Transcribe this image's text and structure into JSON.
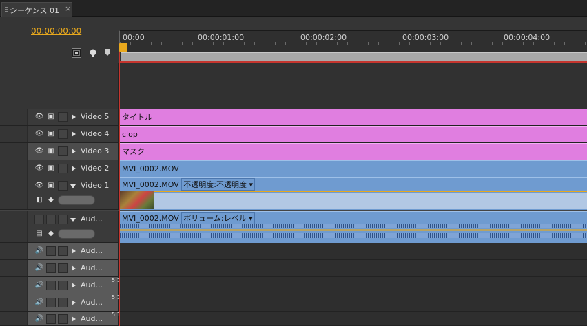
{
  "tab": {
    "title": "シーケンス 01",
    "close": "×"
  },
  "timecode": "00:00:00:00",
  "ruler": {
    "ticks": [
      "00:00",
      "00:00:01:00",
      "00:00:02:00",
      "00:00:03:00",
      "00:00:04:00"
    ]
  },
  "tracks": [
    {
      "name": "Video 5",
      "clip": "タイトル",
      "kind": "video",
      "clip_color": "#e07ee0"
    },
    {
      "name": "Video 4",
      "clip": "clop",
      "kind": "video",
      "clip_color": "#e07ee0"
    },
    {
      "name": "Video 3",
      "clip": "マスク",
      "kind": "video",
      "clip_color": "#e07ee0"
    },
    {
      "name": "Video 2",
      "clip": "MVI_0002.MOV",
      "kind": "video",
      "clip_color": "#6f9bd0"
    },
    {
      "name": "Video 1",
      "clip": "MVI_0002.MOV",
      "effect": "不透明度:不透明度",
      "kind": "video-expanded",
      "clip_color": "#6f9bd0"
    },
    {
      "name": "Aud...",
      "clip": "MVI_0002.MOV",
      "effect": "ボリューム:レベル",
      "kind": "audio-expanded",
      "clip_color": "#6f9bd0"
    },
    {
      "name": "Aud...",
      "kind": "audio"
    },
    {
      "name": "Aud...",
      "kind": "audio"
    },
    {
      "name": "Aud...",
      "badge": "5.1",
      "kind": "audio"
    },
    {
      "name": "Aud...",
      "badge": "5.1",
      "kind": "audio"
    },
    {
      "name": "Aud...",
      "badge": "5.1",
      "kind": "audio"
    }
  ],
  "colors": {
    "timecode": "#e8a81d",
    "video_title_clip": "#e07ee0",
    "media_clip": "#6f9bd0",
    "playhead": "#c5352e"
  }
}
